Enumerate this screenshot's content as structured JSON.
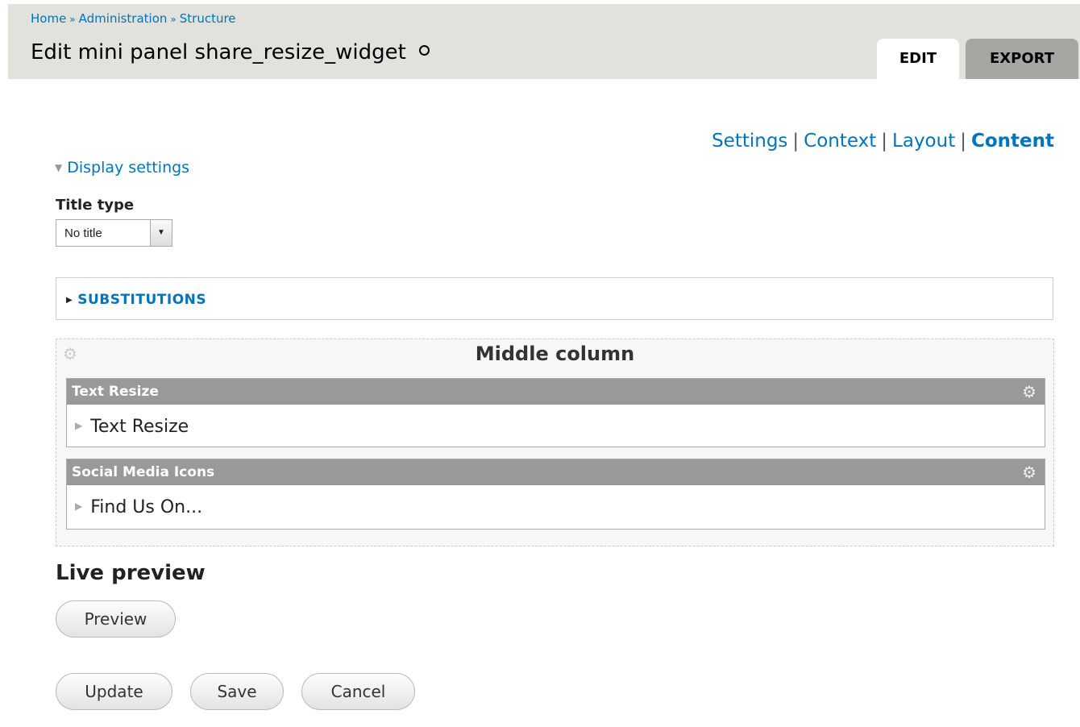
{
  "breadcrumb": {
    "items": [
      "Home",
      "Administration",
      "Structure"
    ],
    "separator": "»"
  },
  "page_title": "Edit mini panel share_resize_widget",
  "tabs": [
    {
      "label": "EDIT",
      "active": true
    },
    {
      "label": "EXPORT",
      "active": false
    }
  ],
  "secondary_links": [
    "Settings",
    "Context",
    "Layout",
    "Content"
  ],
  "secondary_active": "Content",
  "display_settings": {
    "label": "Display settings",
    "icon": "triangle-down-icon"
  },
  "title_type": {
    "label": "Title type",
    "value": "No title"
  },
  "substitutions": {
    "label": "SUBSTITUTIONS",
    "icon": "triangle-right-icon"
  },
  "region": {
    "title": "Middle column",
    "panes": [
      {
        "header": "Text Resize",
        "content": "Text Resize"
      },
      {
        "header": "Social Media Icons",
        "content": "Find Us On..."
      }
    ]
  },
  "live_preview": {
    "heading": "Live preview",
    "preview_label": "Preview"
  },
  "actions": {
    "update_label": "Update",
    "save_label": "Save",
    "cancel_label": "Cancel"
  },
  "colors": {
    "link": "#0074bd",
    "header_bg": "#e1e2dc",
    "pane_header": "#999999"
  }
}
